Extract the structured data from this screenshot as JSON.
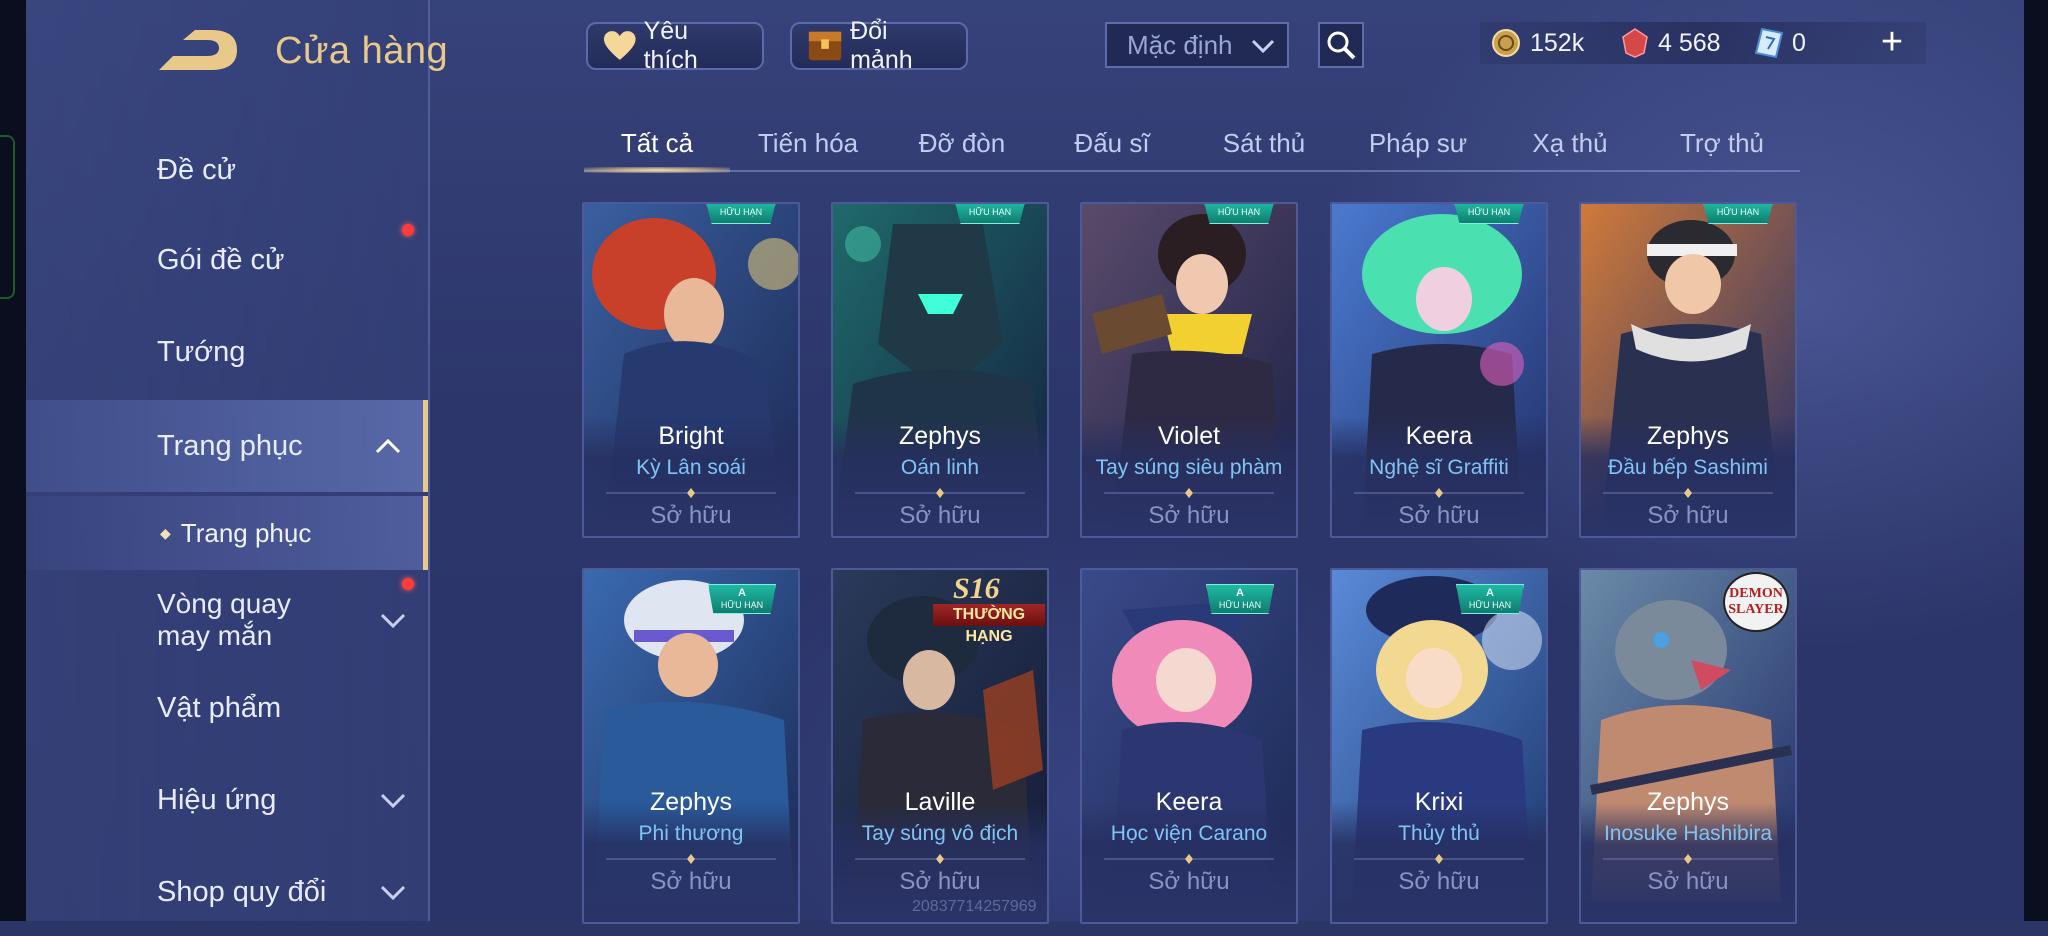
{
  "header": {
    "title": "Cửa hàng",
    "favorites_label": "Yêu thích",
    "exchange_label": "Đổi mảnh",
    "sort_label": "Mặc định"
  },
  "currency": {
    "gold": "152k",
    "ruby": "4 568",
    "coupon": "0",
    "add_label": "+"
  },
  "sidebar": {
    "items": [
      {
        "label": "Đề cử"
      },
      {
        "label": "Gói đề cử"
      },
      {
        "label": "Tướng"
      },
      {
        "label": "Trang phục"
      },
      {
        "label": "Vòng quay may mắn"
      },
      {
        "label": "Vật phẩm"
      },
      {
        "label": "Hiệu ứng"
      },
      {
        "label": "Shop quy đổi"
      }
    ],
    "sub_item": "Trang phục"
  },
  "tabs": [
    {
      "label": "Tất cả"
    },
    {
      "label": "Tiến hóa"
    },
    {
      "label": "Đỡ đòn"
    },
    {
      "label": "Đấu sĩ"
    },
    {
      "label": "Sát thủ"
    },
    {
      "label": "Pháp sư"
    },
    {
      "label": "Xạ thủ"
    },
    {
      "label": "Trợ thủ"
    }
  ],
  "cards": [
    {
      "hero": "Bright",
      "skin": "Kỳ Lân soái",
      "status": "Sở hữu",
      "badge": "HỮU HẠN"
    },
    {
      "hero": "Zephys",
      "skin": "Oán linh",
      "status": "Sở hữu",
      "badge": "HỮU HẠN"
    },
    {
      "hero": "Violet",
      "skin": "Tay súng siêu phàm",
      "status": "Sở hữu",
      "badge": "HỮU HẠN"
    },
    {
      "hero": "Keera",
      "skin": "Nghệ sĩ Graffiti",
      "status": "Sở hữu",
      "badge": "HỮU HẠN"
    },
    {
      "hero": "Zephys",
      "skin": "Đầu bếp Sashimi",
      "status": "Sở hữu",
      "badge": "HỮU HẠN"
    },
    {
      "hero": "Zephys",
      "skin": "Phi thương",
      "status": "Sở hữu",
      "badge": "HỮU HẠN",
      "tier": "A"
    },
    {
      "hero": "Laville",
      "skin": "Tay súng vô địch",
      "status": "Sở hữu",
      "season": "S16",
      "season_rank": "THƯỜNG HẠNG"
    },
    {
      "hero": "Keera",
      "skin": "Học viện Carano",
      "status": "Sở hữu",
      "badge": "HỮU HẠN",
      "tier": "A"
    },
    {
      "hero": "Krixi",
      "skin": "Thủy thủ",
      "status": "Sở hữu",
      "badge": "HỮU HẠN",
      "tier": "A"
    },
    {
      "hero": "Zephys",
      "skin": "Inosuke Hashibira",
      "status": "Sở hữu",
      "logo_line1": "DEMON",
      "logo_line2": "SLAYER"
    }
  ],
  "watermark": "20837714257969",
  "colors": {
    "accent_gold": "#e9c98a",
    "skin_name_blue": "#7fc4f5",
    "badge_teal": "#1fb9a2",
    "notification_red": "#ff3a3a"
  }
}
